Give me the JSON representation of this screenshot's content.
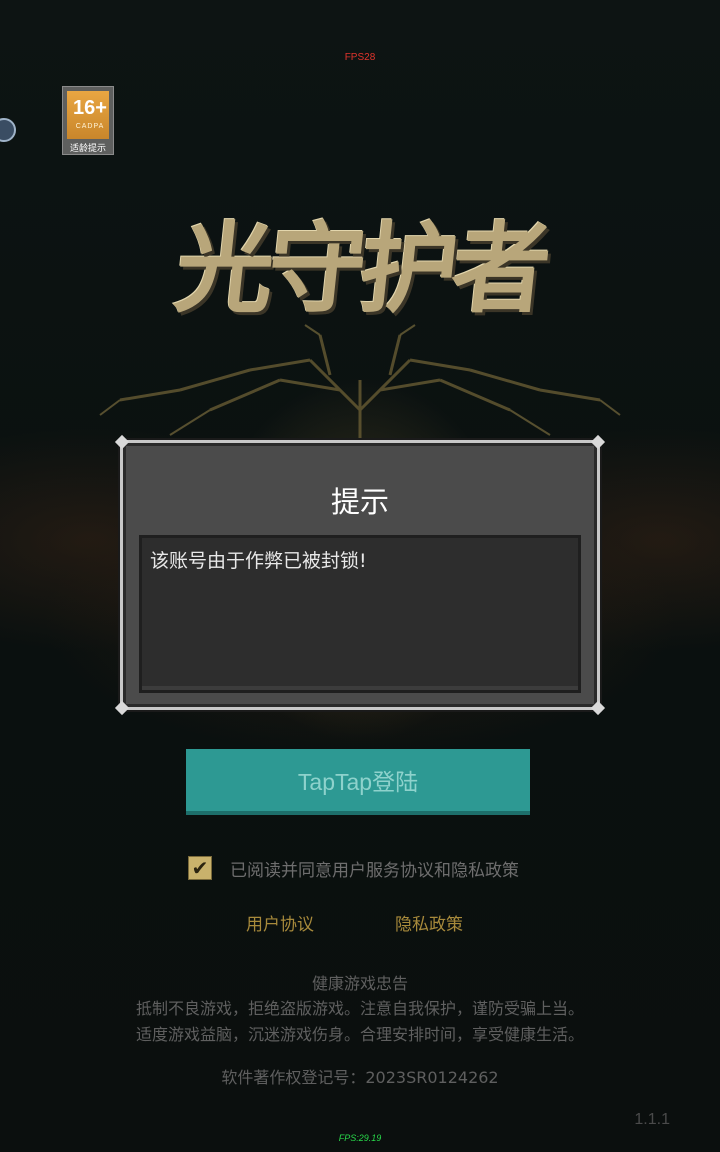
{
  "debug": {
    "fps_top": "FPS28",
    "fps_bottom": "FPS:29.19"
  },
  "age_rating": {
    "age": "16+",
    "org": "CADPA",
    "hint": "适龄提示"
  },
  "game_logo": {
    "title": "光守护者"
  },
  "dialog": {
    "title": "提示",
    "message": "该账号由于作弊已被封锁!"
  },
  "login": {
    "button_label": "TapTap登陆"
  },
  "agreement": {
    "checked": true,
    "check_glyph": "✔",
    "text": "已阅读并同意用户服务协议和隐私政策",
    "user_agreement_link": "用户协议",
    "privacy_link": "隐私政策"
  },
  "health_notice": {
    "title": "健康游戏忠告",
    "line1": "抵制不良游戏，拒绝盗版游戏。注意自我保护，谨防受骗上当。",
    "line2": "适度游戏益脑，沉迷游戏伤身。合理安排时间，享受健康生活。"
  },
  "copyright": "软件著作权登记号：2023SR0124262",
  "version": "1.1.1",
  "colors": {
    "accent_teal": "#2d9993",
    "link_gold": "#a78a3b",
    "checkbox_gold": "#c9b26c",
    "dialog_bg": "#4b4b4b"
  }
}
